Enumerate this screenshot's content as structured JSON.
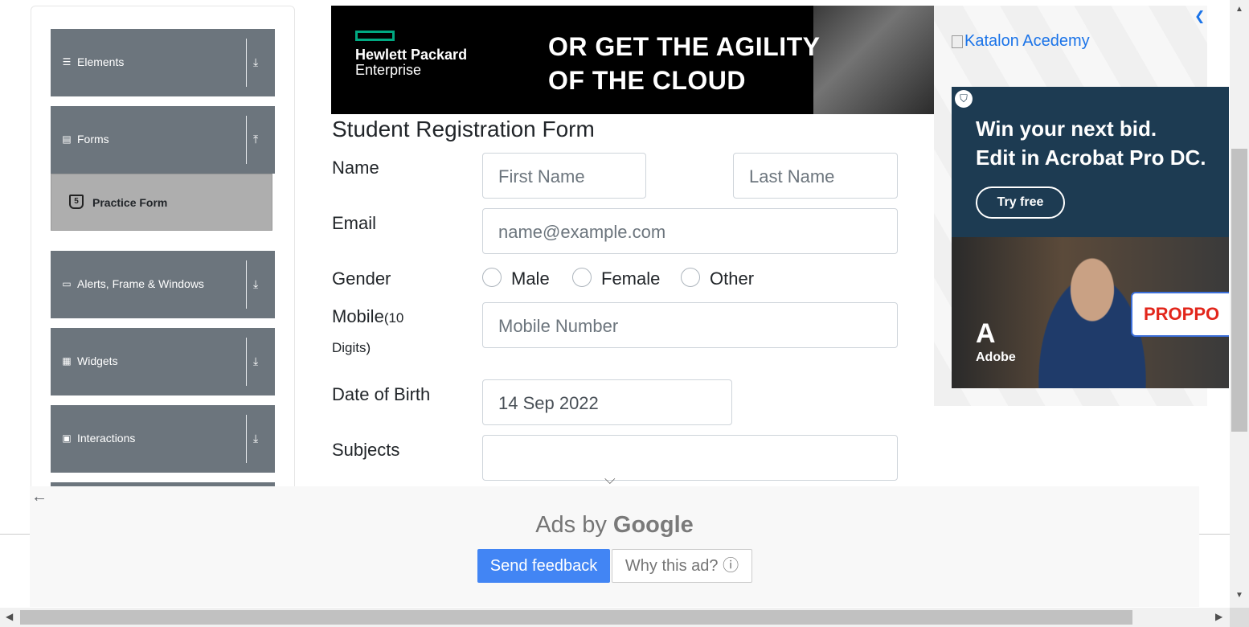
{
  "sidebar": {
    "groups": [
      {
        "label": "Elements",
        "icon": "hamburger-icon",
        "arrow": "download-arrow-icon"
      },
      {
        "label": "Forms",
        "icon": "form-icon",
        "arrow": "upload-arrow-icon"
      },
      {
        "label": "Alerts, Frame & Windows",
        "icon": "window-icon",
        "arrow": "download-arrow-icon"
      },
      {
        "label": "Widgets",
        "icon": "grid-icon",
        "arrow": "download-arrow-icon"
      },
      {
        "label": "Interactions",
        "icon": "interaction-icon",
        "arrow": "download-arrow-icon"
      }
    ],
    "active_item": {
      "label": "Practice Form",
      "icon": "html5-icon"
    }
  },
  "banner_ad": {
    "brand_line1": "Hewlett Packard",
    "brand_line2": "Enterprise",
    "headline": "OR GET THE AGILITY\nOF THE CLOUD",
    "brand_color": "#01a982"
  },
  "form": {
    "title": "Student Registration Form",
    "name_label": "Name",
    "first_name_placeholder": "First Name",
    "last_name_placeholder": "Last Name",
    "email_label": "Email",
    "email_placeholder": "name@example.com",
    "gender_label": "Gender",
    "gender_options": [
      "Male",
      "Female",
      "Other"
    ],
    "mobile_label": "Mobile",
    "mobile_hint": "(10",
    "mobile_hint2": "Digits)",
    "mobile_placeholder": "Mobile Number",
    "dob_label": "Date of Birth",
    "dob_value": "14 Sep 2022",
    "subjects_label": "Subjects",
    "subjects_value": ""
  },
  "right_ads": {
    "katalon_alt": "Katalon Acedemy",
    "acrobat_headline": "Win your next bid.\nEdit in Acrobat Pro DC.",
    "acrobat_cta": "Try free",
    "adobe_label": "Adobe",
    "doc_text": "PROPPO",
    "bg_color": "#1d3b52"
  },
  "google_ads": {
    "ads_by": "Ads by ",
    "google": "Google",
    "send_feedback": "Send feedback",
    "why_this_ad": "Why this ad? ⓘ",
    "accent": "#4285f4"
  }
}
